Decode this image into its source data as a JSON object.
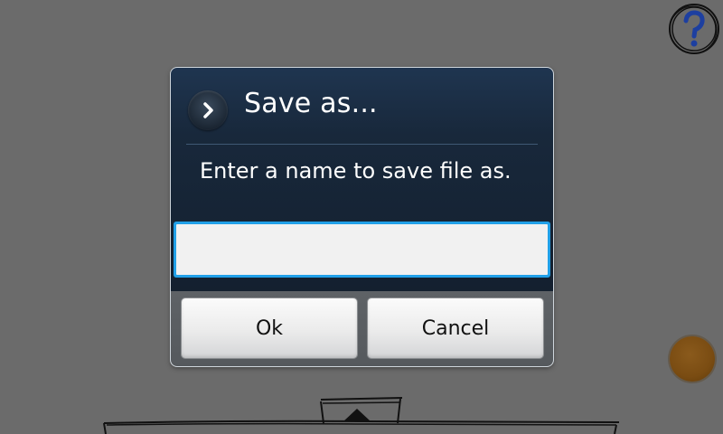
{
  "dialog": {
    "title": "Save as...",
    "message": "Enter a name to save file as.",
    "filename_value": "",
    "ok_label": "Ok",
    "cancel_label": "Cancel"
  },
  "icons": {
    "title": "chevron-right-icon",
    "help": "help-icon"
  },
  "colors": {
    "background": "#6b6b6b",
    "dialog_header": "#18283b",
    "input_focus": "#21a0e8",
    "orb": "#7a4c12"
  }
}
